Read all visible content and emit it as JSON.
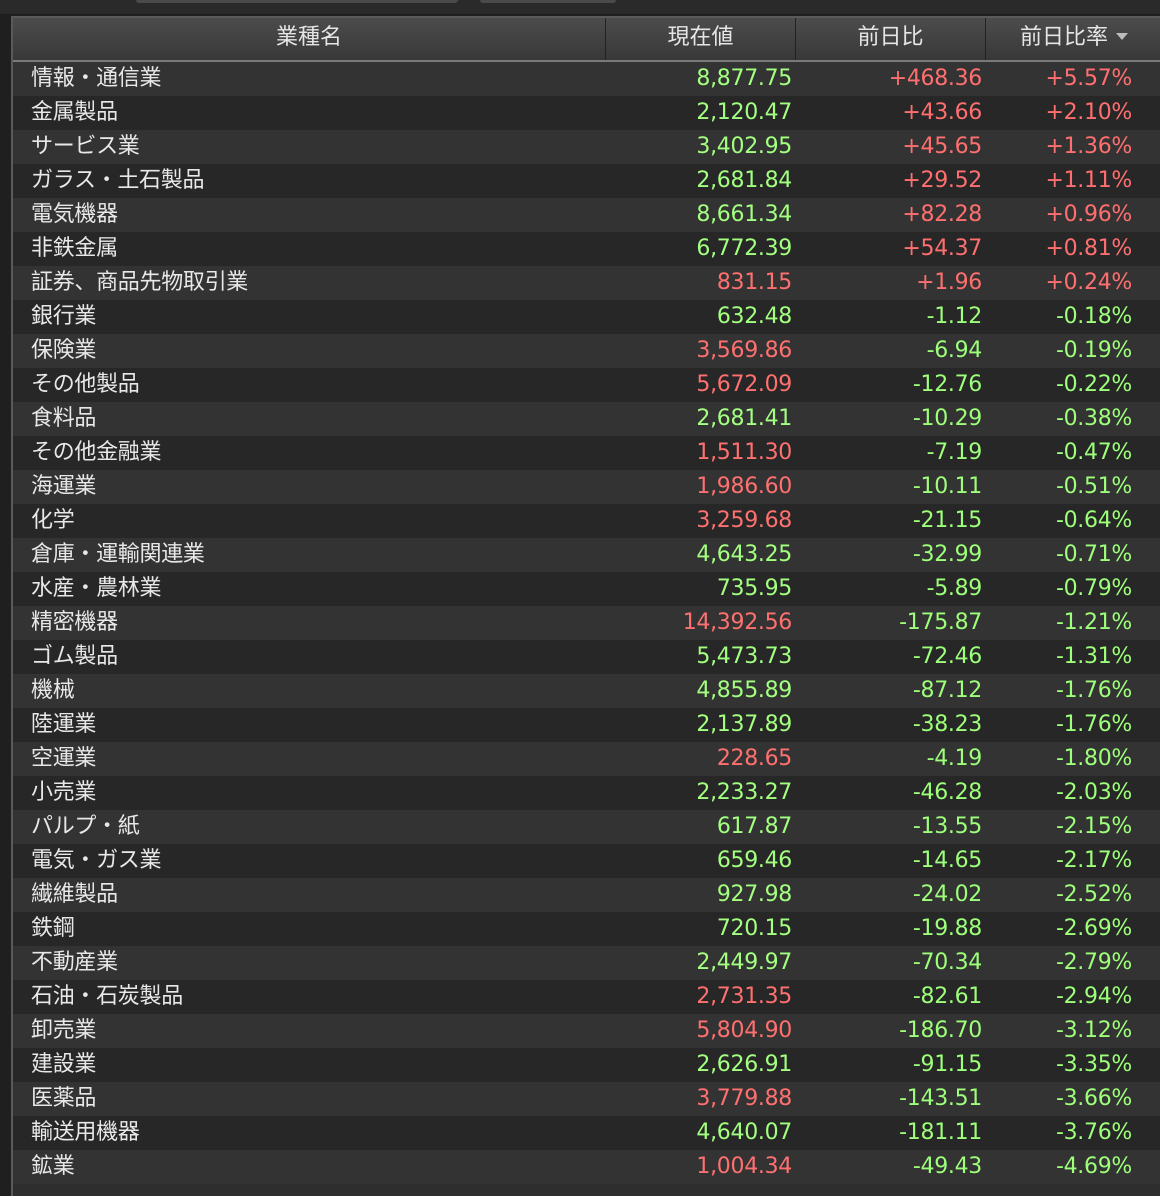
{
  "header": {
    "name": "業種名",
    "price": "現在値",
    "change": "前日比",
    "change_pct": "前日比率"
  },
  "colors": {
    "up": "#ff6f6f",
    "down": "#9dff7a",
    "background": "#1f1f1f",
    "row_odd": "#333333",
    "row_even": "#272727"
  },
  "rows": [
    {
      "name": "情報・通信業",
      "price": "8,877.75",
      "price_color": "green",
      "change": "+468.36",
      "change_pct": "+5.57%"
    },
    {
      "name": "金属製品",
      "price": "2,120.47",
      "price_color": "green",
      "change": "+43.66",
      "change_pct": "+2.10%"
    },
    {
      "name": "サービス業",
      "price": "3,402.95",
      "price_color": "green",
      "change": "+45.65",
      "change_pct": "+1.36%"
    },
    {
      "name": "ガラス・土石製品",
      "price": "2,681.84",
      "price_color": "green",
      "change": "+29.52",
      "change_pct": "+1.11%"
    },
    {
      "name": "電気機器",
      "price": "8,661.34",
      "price_color": "green",
      "change": "+82.28",
      "change_pct": "+0.96%"
    },
    {
      "name": "非鉄金属",
      "price": "6,772.39",
      "price_color": "green",
      "change": "+54.37",
      "change_pct": "+0.81%"
    },
    {
      "name": "証券、商品先物取引業",
      "price": "831.15",
      "price_color": "red",
      "change": "+1.96",
      "change_pct": "+0.24%"
    },
    {
      "name": "銀行業",
      "price": "632.48",
      "price_color": "green",
      "change": "-1.12",
      "change_pct": "-0.18%"
    },
    {
      "name": "保険業",
      "price": "3,569.86",
      "price_color": "red",
      "change": "-6.94",
      "change_pct": "-0.19%"
    },
    {
      "name": "その他製品",
      "price": "5,672.09",
      "price_color": "red",
      "change": "-12.76",
      "change_pct": "-0.22%"
    },
    {
      "name": "食料品",
      "price": "2,681.41",
      "price_color": "green",
      "change": "-10.29",
      "change_pct": "-0.38%"
    },
    {
      "name": "その他金融業",
      "price": "1,511.30",
      "price_color": "red",
      "change": "-7.19",
      "change_pct": "-0.47%"
    },
    {
      "name": "海運業",
      "price": "1,986.60",
      "price_color": "red",
      "change": "-10.11",
      "change_pct": "-0.51%"
    },
    {
      "name": "化学",
      "price": "3,259.68",
      "price_color": "red",
      "change": "-21.15",
      "change_pct": "-0.64%"
    },
    {
      "name": "倉庫・運輸関連業",
      "price": "4,643.25",
      "price_color": "green",
      "change": "-32.99",
      "change_pct": "-0.71%"
    },
    {
      "name": "水産・農林業",
      "price": "735.95",
      "price_color": "green",
      "change": "-5.89",
      "change_pct": "-0.79%"
    },
    {
      "name": "精密機器",
      "price": "14,392.56",
      "price_color": "red",
      "change": "-175.87",
      "change_pct": "-1.21%"
    },
    {
      "name": "ゴム製品",
      "price": "5,473.73",
      "price_color": "green",
      "change": "-72.46",
      "change_pct": "-1.31%"
    },
    {
      "name": "機械",
      "price": "4,855.89",
      "price_color": "green",
      "change": "-87.12",
      "change_pct": "-1.76%"
    },
    {
      "name": "陸運業",
      "price": "2,137.89",
      "price_color": "green",
      "change": "-38.23",
      "change_pct": "-1.76%"
    },
    {
      "name": "空運業",
      "price": "228.65",
      "price_color": "red",
      "change": "-4.19",
      "change_pct": "-1.80%"
    },
    {
      "name": "小売業",
      "price": "2,233.27",
      "price_color": "green",
      "change": "-46.28",
      "change_pct": "-2.03%"
    },
    {
      "name": "パルプ・紙",
      "price": "617.87",
      "price_color": "green",
      "change": "-13.55",
      "change_pct": "-2.15%"
    },
    {
      "name": "電気・ガス業",
      "price": "659.46",
      "price_color": "green",
      "change": "-14.65",
      "change_pct": "-2.17%"
    },
    {
      "name": "繊維製品",
      "price": "927.98",
      "price_color": "green",
      "change": "-24.02",
      "change_pct": "-2.52%"
    },
    {
      "name": "鉄鋼",
      "price": "720.15",
      "price_color": "green",
      "change": "-19.88",
      "change_pct": "-2.69%"
    },
    {
      "name": "不動産業",
      "price": "2,449.97",
      "price_color": "green",
      "change": "-70.34",
      "change_pct": "-2.79%"
    },
    {
      "name": "石油・石炭製品",
      "price": "2,731.35",
      "price_color": "red",
      "change": "-82.61",
      "change_pct": "-2.94%"
    },
    {
      "name": "卸売業",
      "price": "5,804.90",
      "price_color": "red",
      "change": "-186.70",
      "change_pct": "-3.12%"
    },
    {
      "name": "建設業",
      "price": "2,626.91",
      "price_color": "green",
      "change": "-91.15",
      "change_pct": "-3.35%"
    },
    {
      "name": "医薬品",
      "price": "3,779.88",
      "price_color": "red",
      "change": "-143.51",
      "change_pct": "-3.66%"
    },
    {
      "name": "輸送用機器",
      "price": "4,640.07",
      "price_color": "green",
      "change": "-181.11",
      "change_pct": "-3.76%"
    },
    {
      "name": "鉱業",
      "price": "1,004.34",
      "price_color": "red",
      "change": "-49.43",
      "change_pct": "-4.69%"
    }
  ]
}
